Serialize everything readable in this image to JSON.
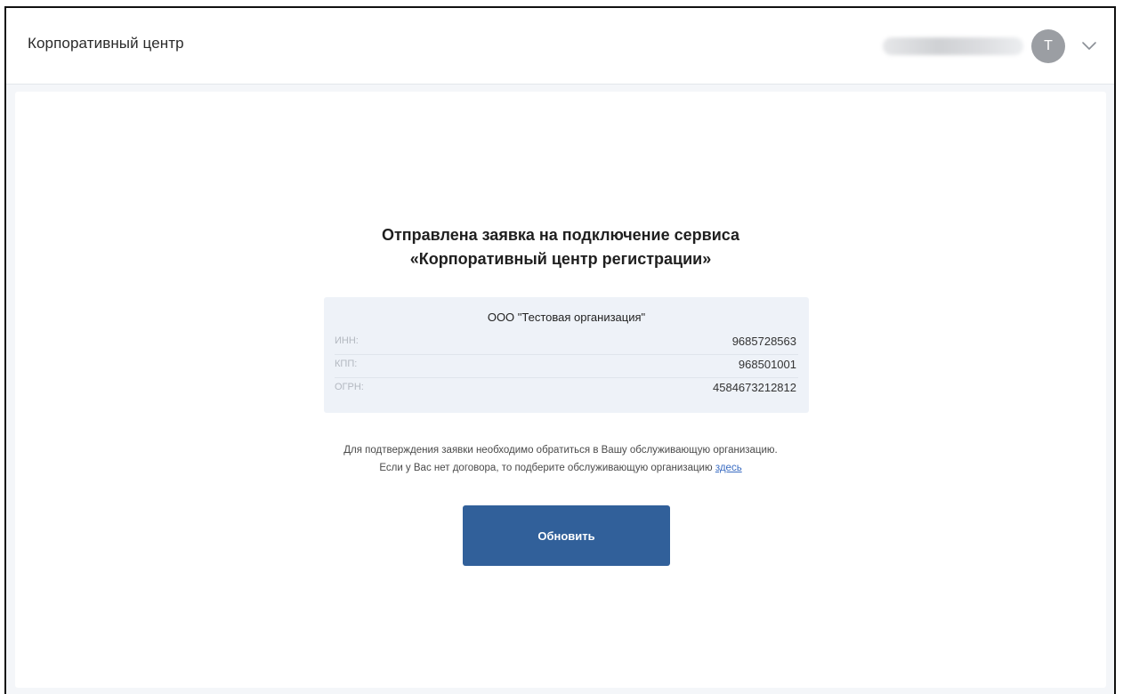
{
  "header": {
    "app_title": "Корпоративный центр",
    "user_avatar_initial": "T"
  },
  "main": {
    "heading_line1": "Отправлена заявка на подключение сервиса",
    "heading_line2": "«Корпоративный центр регистрации»",
    "organization": {
      "name": "ООО \"Тестовая организация\"",
      "rows": [
        {
          "label": "ИНН:",
          "value": "9685728563"
        },
        {
          "label": "КПП:",
          "value": "968501001"
        },
        {
          "label": "ОГРН:",
          "value": "4584673212812"
        }
      ]
    },
    "note_line1": "Для подтверждения заявки необходимо обратиться в Вашу обслуживающую организацию.",
    "note_line2_prefix": "Если у Вас нет договора, то подберите обслуживающую организацию",
    "note_link": "здесь",
    "refresh_label": "Обновить"
  },
  "colors": {
    "primary_button": "#31609a",
    "link": "#3a6cc2",
    "card_background": "#eef2f8"
  }
}
